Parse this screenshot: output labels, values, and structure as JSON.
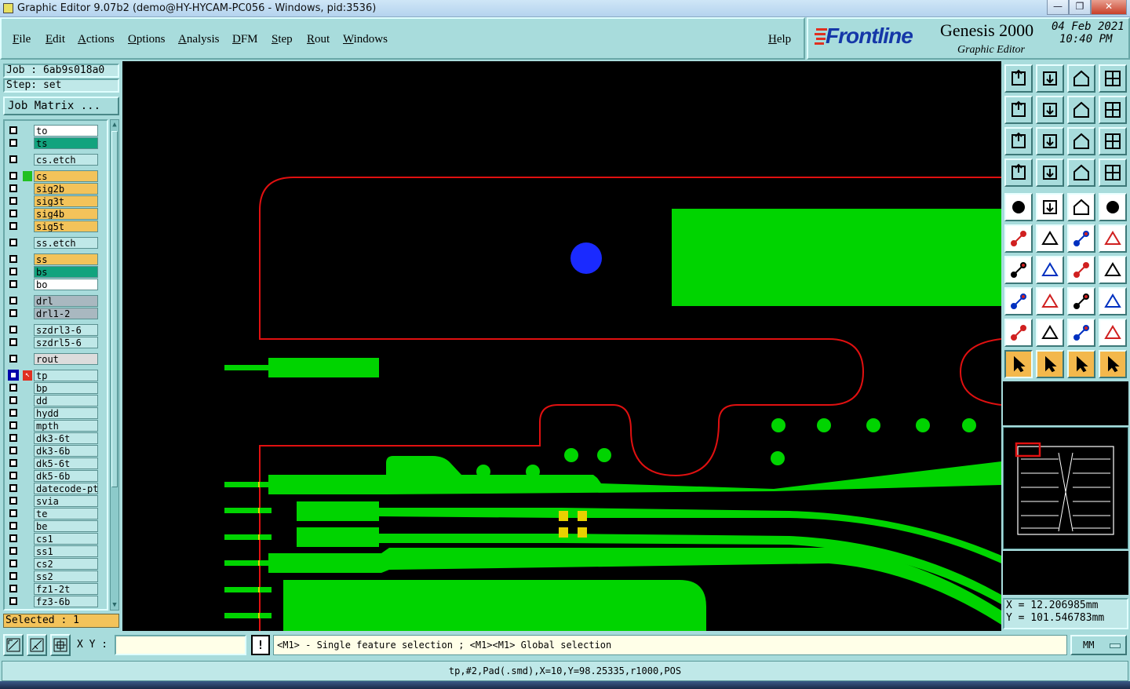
{
  "window": {
    "title": "Graphic Editor 9.07b2 (demo@HY-HYCAM-PC056 - Windows, pid:3536)",
    "min_label": "—",
    "max_label": "❐",
    "close_label": "✕"
  },
  "menubar": {
    "items": [
      "File",
      "Edit",
      "Actions",
      "Options",
      "Analysis",
      "DFM",
      "Step",
      "Rout",
      "Windows"
    ],
    "help": "Help"
  },
  "brand": {
    "logo": "Frontline",
    "product": "Genesis 2000",
    "subtitle": "Graphic Editor",
    "date": "04 Feb 2021",
    "time": "10:40 PM"
  },
  "job": {
    "job_line": "Job : 6ab9s018a0",
    "step_line": "Step: set",
    "matrix_button": "Job Matrix ..."
  },
  "layers": [
    {
      "name": "to",
      "color": "#ffffff",
      "state": ""
    },
    {
      "name": "ts",
      "color": "#12a37e",
      "state": ""
    },
    {
      "name": "cs.etch",
      "color": "#bfe8e8",
      "state": ""
    },
    {
      "name": "cs",
      "color": "#f3c35a",
      "state": "green"
    },
    {
      "name": "sig2b",
      "color": "#f3c35a",
      "state": ""
    },
    {
      "name": "sig3t",
      "color": "#f3c35a",
      "state": ""
    },
    {
      "name": "sig4b",
      "color": "#f3c35a",
      "state": ""
    },
    {
      "name": "sig5t",
      "color": "#f3c35a",
      "state": ""
    },
    {
      "name": "ss.etch",
      "color": "#bfe8e8",
      "state": ""
    },
    {
      "name": "ss",
      "color": "#f3c35a",
      "state": ""
    },
    {
      "name": "bs",
      "color": "#12a37e",
      "state": ""
    },
    {
      "name": "bo",
      "color": "#ffffff",
      "state": ""
    },
    {
      "name": "drl",
      "color": "#a9b8c0",
      "state": ""
    },
    {
      "name": "drl1-2",
      "color": "#a9b8c0",
      "state": ""
    },
    {
      "name": "szdrl3-6",
      "color": "#bfe8e8",
      "state": ""
    },
    {
      "name": "szdrl5-6",
      "color": "#bfe8e8",
      "state": ""
    },
    {
      "name": "rout",
      "color": "#dcdcdc",
      "state": ""
    },
    {
      "name": "tp",
      "color": "#bfe8e8",
      "state": "work"
    },
    {
      "name": "bp",
      "color": "#bfe8e8",
      "state": ""
    },
    {
      "name": "dd",
      "color": "#bfe8e8",
      "state": ""
    },
    {
      "name": "hydd",
      "color": "#bfe8e8",
      "state": ""
    },
    {
      "name": "mpth",
      "color": "#bfe8e8",
      "state": ""
    },
    {
      "name": "dk3-6t",
      "color": "#bfe8e8",
      "state": ""
    },
    {
      "name": "dk3-6b",
      "color": "#bfe8e8",
      "state": ""
    },
    {
      "name": "dk5-6t",
      "color": "#bfe8e8",
      "state": ""
    },
    {
      "name": "dk5-6b",
      "color": "#bfe8e8",
      "state": ""
    },
    {
      "name": "datecode-pt",
      "color": "#bfe8e8",
      "state": ""
    },
    {
      "name": "svia",
      "color": "#bfe8e8",
      "state": ""
    },
    {
      "name": "te",
      "color": "#bfe8e8",
      "state": ""
    },
    {
      "name": "be",
      "color": "#bfe8e8",
      "state": ""
    },
    {
      "name": "cs1",
      "color": "#bfe8e8",
      "state": ""
    },
    {
      "name": "ss1",
      "color": "#bfe8e8",
      "state": ""
    },
    {
      "name": "cs2",
      "color": "#bfe8e8",
      "state": ""
    },
    {
      "name": "ss2",
      "color": "#bfe8e8",
      "state": ""
    },
    {
      "name": "fz1-2t",
      "color": "#bfe8e8",
      "state": ""
    },
    {
      "name": "fz3-6b",
      "color": "#bfe8e8",
      "state": ""
    }
  ],
  "selected": "Selected : 1",
  "coords": {
    "x": "X  =  12.206985mm",
    "y": "Y  = 101.546783mm"
  },
  "bottom": {
    "xy_label": "X Y :",
    "xy_value": "",
    "bang": "!",
    "hint": "<M1> - Single feature selection ; <M1><M1> Global selection",
    "units": "MM"
  },
  "status": "tp,#2,Pad(.smd),X=10,Y=98.25335,r1000,POS",
  "colors": {
    "feature": "#00d400",
    "profile": "#e01010",
    "highlight": "#1a2aff",
    "pad_yellow": "#e8d000",
    "panel": "#a8dcdc"
  },
  "toolbar_icons": [
    "zoom-home-icon",
    "zoom-fit-icon",
    "home-view-icon",
    "split-view-icon",
    "pan-left-icon",
    "pan-right-icon",
    "flip-view-icon",
    "snap-icon",
    "zoom-extent-icon",
    "zoom-center-icon",
    "scale-1-2-icon",
    "help-query-icon",
    "measure-tool-icon",
    "grid-icon",
    "layer-compare-icon",
    "layer-compare-red-icon",
    "pad-tool-icon",
    "polygon-tool-icon",
    "ruler-icon",
    "circle-tool-icon",
    "connect-nodes-icon",
    "cross-tool-icon",
    "line-dot-icon",
    "line-dot-alt-icon",
    "angle-red-icon",
    "angle-line-icon",
    "rotate-icon",
    "mirror-text-icon",
    "snap-square-icon",
    "horizontal-line-icon",
    "box-center-icon",
    "shape-group-icon",
    "triangle-tool-icon",
    "triangle-up-icon",
    "triangle-arrow-icon",
    "triangle-flat-icon",
    "select-arrow-icon",
    "select-box-icon",
    "select-circle-icon",
    "select-connect-icon"
  ]
}
